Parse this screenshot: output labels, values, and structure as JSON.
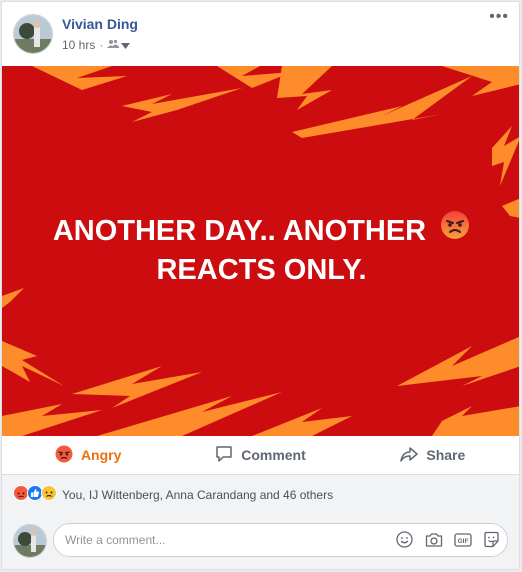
{
  "post": {
    "author": "Vivian Ding",
    "timestamp": "10 hrs",
    "separator": "·",
    "audience_icon": "friends-icon",
    "more_label": "•••",
    "image": {
      "headline_line1": "ANOTHER DAY.. ANOTHER",
      "headline_line2": "REACTS ONLY.",
      "background_color": "#cc0c0f",
      "bolt_color": "#ff8c2a",
      "emoji": "angry-face-icon"
    }
  },
  "actions": {
    "react_label": "Angry",
    "comment_label": "Comment",
    "share_label": "Share"
  },
  "reactions": {
    "icons": [
      "angry-reaction-icon",
      "like-reaction-icon",
      "sad-reaction-icon"
    ],
    "summary": "You, IJ Wittenberg, Anna Carandang and 46 others"
  },
  "comment": {
    "placeholder": "Write a comment...",
    "tools": [
      "emoji-icon",
      "camera-icon",
      "gif-icon",
      "sticker-icon"
    ]
  },
  "colors": {
    "link_blue": "#365899",
    "angry_orange": "#e9710f",
    "gray_text": "#606770"
  }
}
